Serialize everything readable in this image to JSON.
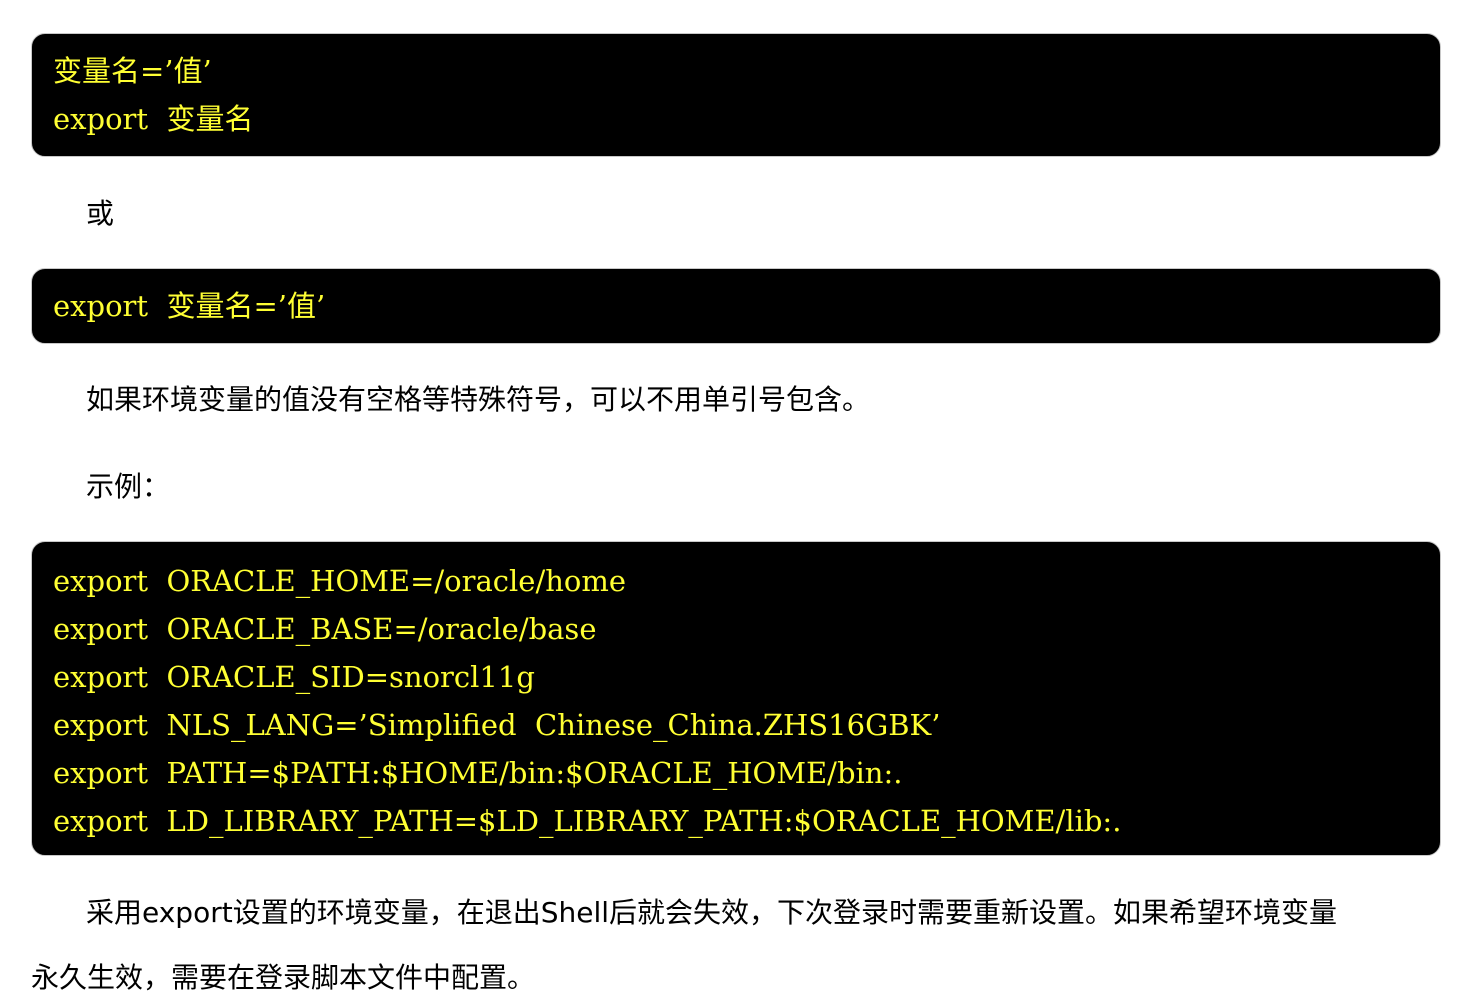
{
  "blocks": {
    "syntax1": [
      "变量名=’值’",
      "export  变量名"
    ],
    "syntax2": [
      "export  变量名=’值’"
    ],
    "example": [
      "export  ORACLE_HOME=/oracle/home",
      "export  ORACLE_BASE=/oracle/base",
      "export  ORACLE_SID=snorcl11g",
      "export  NLS_LANG=’Simplified  Chinese_China.ZHS16GBK’",
      "export  PATH=$PATH:$HOME/bin:$ORACLE_HOME/bin:.",
      "export  LD_LIBRARY_PATH=$LD_LIBRARY_PATH:$ORACLE_HOME/lib:."
    ]
  },
  "text": {
    "or": "或",
    "note": "如果环境变量的值没有空格等特殊符号，可以不用单引号包含。",
    "example_label": "示例：",
    "conclusion_line1": "采用export设置的环境变量，在退出Shell后就会失效，下次登录时需要重新设置。如果希望环境变量",
    "conclusion_line2": "永久生效，需要在登录脚本文件中配置。"
  },
  "colors": {
    "code_background": "#000000",
    "code_text": "#ffff33"
  }
}
